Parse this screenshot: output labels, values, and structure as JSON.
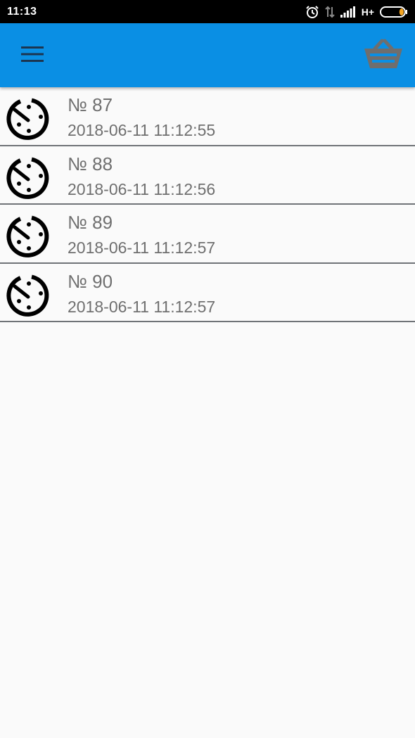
{
  "status_bar": {
    "time": "11:13",
    "network": "H+",
    "icons": [
      "alarm-icon",
      "data-transfer-icon",
      "signal-icon",
      "battery-icon"
    ],
    "battery_level": 0.2,
    "battery_color": "#f5a623"
  },
  "app_bar": {
    "color": "#0a8fe4",
    "menu_icon": "hamburger-menu-icon",
    "basket_icon": "basket-icon"
  },
  "orders": [
    {
      "number": "№ 87",
      "datetime": "2018-06-11 11:12:55",
      "icon": "stopwatch-icon"
    },
    {
      "number": "№ 88",
      "datetime": "2018-06-11 11:12:56",
      "icon": "stopwatch-icon"
    },
    {
      "number": "№ 89",
      "datetime": "2018-06-11 11:12:57",
      "icon": "stopwatch-icon"
    },
    {
      "number": "№ 90",
      "datetime": "2018-06-11 11:12:57",
      "icon": "stopwatch-icon"
    }
  ]
}
